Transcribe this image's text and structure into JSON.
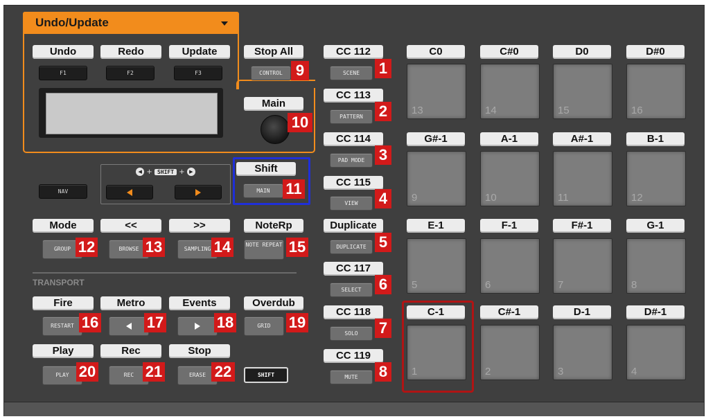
{
  "colors": {
    "accent_orange": "#f28c1c",
    "badge_red": "#d21a1a",
    "highlight_blue": "#1f2fd9",
    "selected_pad_red": "#b01414"
  },
  "dropdown": {
    "title": "Undo/Update",
    "icon": "caret-down-icon"
  },
  "top_left": {
    "labels": [
      "Undo",
      "Redo",
      "Update"
    ],
    "fkeys": [
      "F1",
      "F2",
      "F3"
    ]
  },
  "stop_all": {
    "label": "Stop All",
    "hw": "CONTROL",
    "num": "9"
  },
  "main": {
    "label": "Main",
    "num": "10"
  },
  "shift_group": {
    "label": "Shift",
    "hw": "MAIN",
    "num": "11",
    "combo_text": "SHIFT",
    "combo_plus": "+"
  },
  "nav": {
    "hw": "NAV"
  },
  "row_mode": [
    {
      "label": "Mode",
      "hw": "GROUP",
      "num": "12"
    },
    {
      "label": "<<",
      "hw": "BROWSE",
      "num": "13"
    },
    {
      "label": ">>",
      "hw": "SAMPLING",
      "num": "14"
    },
    {
      "label": "NoteRp",
      "hw": "NOTE REPEAT",
      "num": "15"
    }
  ],
  "transport": {
    "title": "TRANSPORT"
  },
  "row_fire": [
    {
      "label": "Fire",
      "hw": "RESTART",
      "num": "16"
    },
    {
      "label": "Metro",
      "hw": "",
      "num": "17"
    },
    {
      "label": "Events",
      "hw": "",
      "num": "18"
    },
    {
      "label": "Overdub",
      "hw": "GRID",
      "num": "19"
    }
  ],
  "row_play": [
    {
      "label": "Play",
      "hw": "PLAY",
      "num": "20"
    },
    {
      "label": "Rec",
      "hw": "REC",
      "num": "21"
    },
    {
      "label": "Stop",
      "hw": "ERASE",
      "num": "22"
    }
  ],
  "shift_button": {
    "hw": "SHIFT"
  },
  "cc_column": [
    {
      "label": "CC 112",
      "hw": "SCENE",
      "num": "1"
    },
    {
      "label": "CC 113",
      "hw": "PATTERN",
      "num": "2"
    },
    {
      "label": "CC 114",
      "hw": "PAD MODE",
      "num": "3"
    },
    {
      "label": "CC 115",
      "hw": "VIEW",
      "num": "4"
    },
    {
      "label": "Duplicate",
      "hw": "DUPLICATE",
      "num": "5"
    },
    {
      "label": "CC 117",
      "hw": "SELECT",
      "num": "6"
    },
    {
      "label": "CC 118",
      "hw": "SOLO",
      "num": "7"
    },
    {
      "label": "CC 119",
      "hw": "MUTE",
      "num": "8"
    }
  ],
  "pad_rows": [
    {
      "notes": [
        "C0",
        "C#0",
        "D0",
        "D#0"
      ],
      "pads": [
        "13",
        "14",
        "15",
        "16"
      ]
    },
    {
      "notes": [
        "G#-1",
        "A-1",
        "A#-1",
        "B-1"
      ],
      "pads": [
        "9",
        "10",
        "11",
        "12"
      ]
    },
    {
      "notes": [
        "E-1",
        "F-1",
        "F#-1",
        "G-1"
      ],
      "pads": [
        "5",
        "6",
        "7",
        "8"
      ]
    },
    {
      "notes": [
        "C-1",
        "C#-1",
        "D-1",
        "D#-1"
      ],
      "pads": [
        "1",
        "2",
        "3",
        "4"
      ]
    }
  ],
  "selected_pad": "1"
}
